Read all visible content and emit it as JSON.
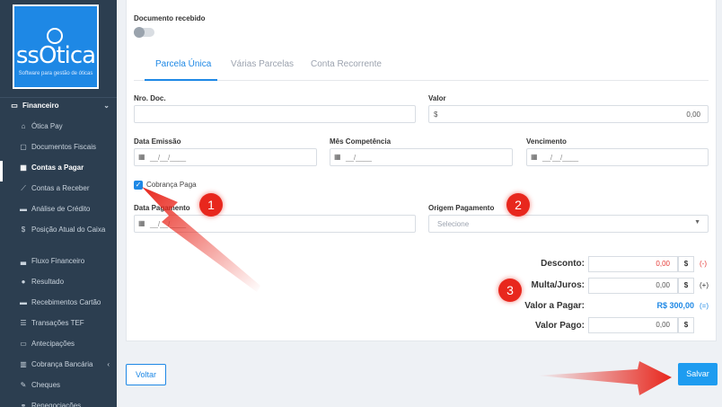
{
  "brand": {
    "logo_text": "ssOtica",
    "logo_subtitle": "Software para gestão de óticas"
  },
  "sidebar": {
    "items": [
      {
        "label": "Financeiro",
        "icon": "money-icon",
        "glyph": "▭",
        "type": "parent",
        "caret": "⌄"
      },
      {
        "label": "Ótica Pay",
        "icon": "bank-icon",
        "glyph": "⌂"
      },
      {
        "label": "Documentos Fiscais",
        "icon": "document-icon",
        "glyph": "▢"
      },
      {
        "label": "Contas a Pagar",
        "icon": "calculator-icon",
        "glyph": "▦",
        "type": "active"
      },
      {
        "label": "Contas a Receber",
        "icon": "line-chart-icon",
        "glyph": "⟋"
      },
      {
        "label": "Análise de Crédito",
        "icon": "id-card-icon",
        "glyph": "▬"
      },
      {
        "label": "Posição Atual do Caixa",
        "icon": "dollar-icon",
        "glyph": "$",
        "type": "tall"
      },
      {
        "label": "Fluxo Financeiro",
        "icon": "area-chart-icon",
        "glyph": "▃"
      },
      {
        "label": "Resultado",
        "icon": "pie-chart-icon",
        "glyph": "●"
      },
      {
        "label": "Recebimentos Cartão",
        "icon": "card-icon",
        "glyph": "▬"
      },
      {
        "label": "Transações TEF",
        "icon": "list-icon",
        "glyph": "☰"
      },
      {
        "label": "Antecipações",
        "icon": "card-icon",
        "glyph": "▭"
      },
      {
        "label": "Cobrança Bancária",
        "icon": "barcode-icon",
        "glyph": "▥",
        "caret": "‹"
      },
      {
        "label": "Cheques",
        "icon": "edit-icon",
        "glyph": "✎"
      },
      {
        "label": "Renegociações",
        "icon": "handshake-icon",
        "glyph": "⚭"
      }
    ]
  },
  "form": {
    "documento_recebido_label": "Documento recebido",
    "tabs": [
      "Parcela Única",
      "Várias Parcelas",
      "Conta Recorrente"
    ],
    "nro_doc_label": "Nro. Doc.",
    "nro_doc_value": "",
    "valor_label": "Valor",
    "valor_prefix": "$",
    "valor_value": "0,00",
    "data_emissao_label": "Data Emissão",
    "mes_competencia_label": "Mês Competência",
    "vencimento_label": "Vencimento",
    "date_placeholder": "__/__/____",
    "month_placeholder": "__/____",
    "cobranca_paga_label": "Cobrança Paga",
    "cobranca_paga_checked": true,
    "data_pagamento_label": "Data Pagamento",
    "origem_pagamento_label": "Origem Pagamento",
    "origem_pagamento_placeholder": "Selecione"
  },
  "summary": {
    "desconto_label": "Desconto:",
    "desconto_value": "0,00",
    "desconto_currency": "$",
    "desconto_sign": "(-)",
    "multa_label": "Multa/Juros:",
    "multa_value": "0,00",
    "multa_currency": "$",
    "multa_sign": "(+)",
    "valor_a_pagar_label": "Valor a Pagar:",
    "valor_a_pagar_value": "R$ 300,00",
    "valor_a_pagar_sign": "(=)",
    "valor_pago_label": "Valor Pago:",
    "valor_pago_value": "0,00",
    "valor_pago_currency": "$"
  },
  "annotations": {
    "badge_1": "1",
    "badge_2": "2",
    "badge_3": "3"
  },
  "actions": {
    "voltar_label": "Voltar",
    "salvar_label": "Salvar"
  },
  "colors": {
    "accent": "#1e88e5",
    "sidebar": "#2c3e50",
    "annotation_red": "#e8271d",
    "discount_red": "#e53935"
  }
}
